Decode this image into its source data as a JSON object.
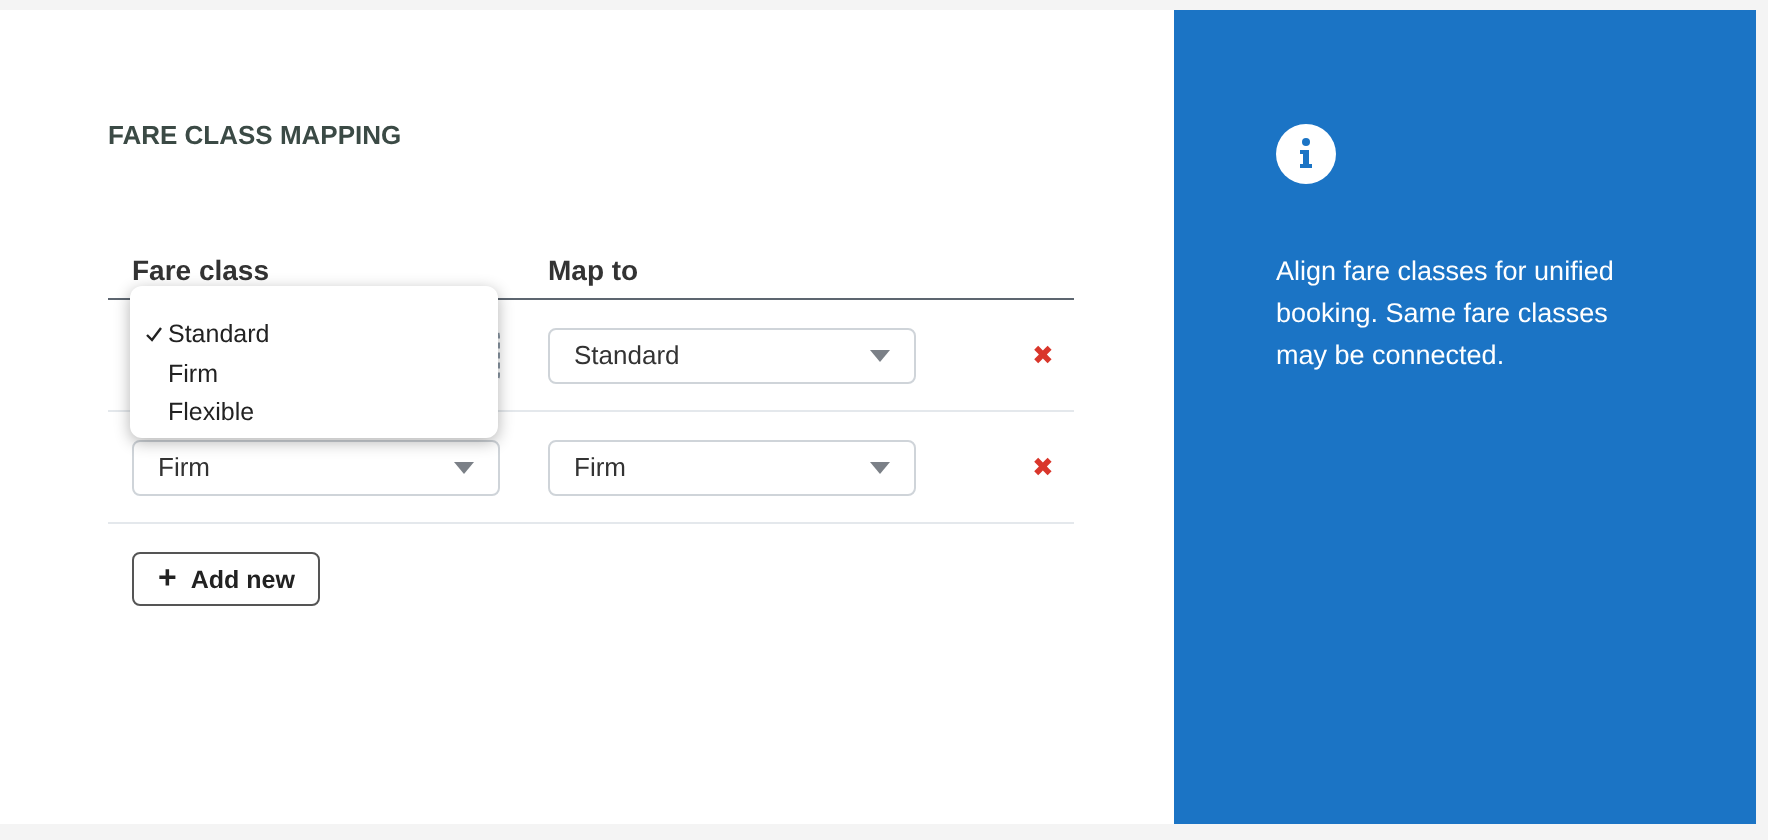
{
  "title": "FARE CLASS MAPPING",
  "table": {
    "columns": [
      "Fare class",
      "Map to"
    ],
    "rows": [
      {
        "fare_class": "",
        "map_to": "Standard",
        "delete": "✖",
        "open": true
      },
      {
        "fare_class": "Firm",
        "map_to": "Firm",
        "delete": "✖",
        "open": false
      }
    ]
  },
  "dropdown": {
    "options": [
      {
        "label": "Standard",
        "selected": true
      },
      {
        "label": "Firm",
        "selected": false
      },
      {
        "label": "Flexible",
        "selected": false
      }
    ]
  },
  "add_button": {
    "icon": "+",
    "label": "Add new"
  },
  "info": {
    "text": "Align fare classes for unified booking. Same fare classes may be connected."
  }
}
